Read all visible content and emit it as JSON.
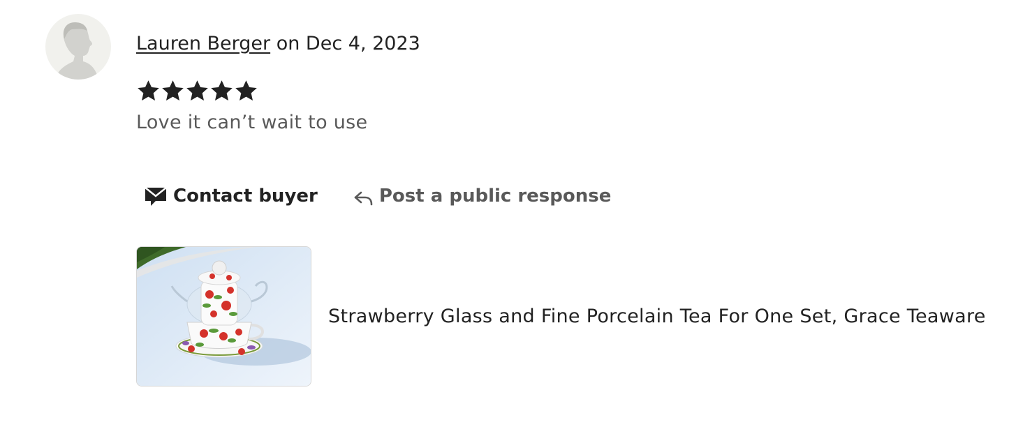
{
  "review": {
    "reviewer_name": "Lauren Berger",
    "date_text": "on Dec 4, 2023",
    "rating": 5,
    "rating_max": 5,
    "text": "Love it can’t wait to use"
  },
  "actions": {
    "contact_label": "Contact buyer",
    "respond_label": "Post a public response"
  },
  "product": {
    "title": "Strawberry Glass and Fine Porcelain Tea For One Set, Grace Teaware"
  },
  "icons": {
    "avatar": "person-silhouette-icon",
    "star": "star-icon",
    "contact": "envelope-icon",
    "respond": "reply-arrow-icon"
  },
  "colors": {
    "text_primary": "#222222",
    "text_secondary": "#595959",
    "avatar_bg": "#f1f1ed"
  }
}
